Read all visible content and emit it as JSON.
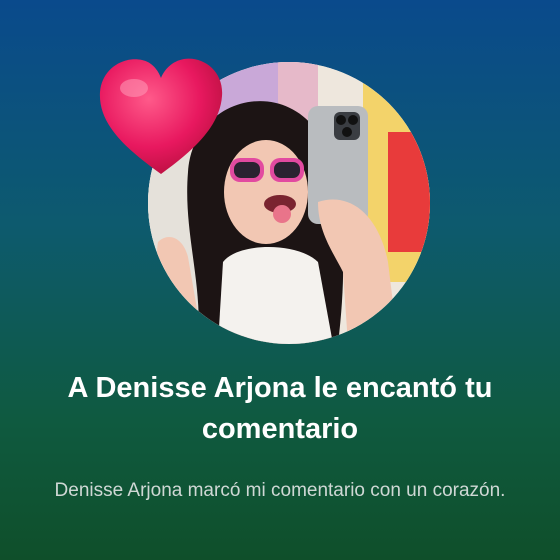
{
  "notification": {
    "title": "A Denisse Arjona le encantó tu comentario",
    "body": "Denisse Arjona marcó mi comentario con un corazón."
  },
  "avatar": {
    "icon": "profile-photo"
  },
  "reaction": {
    "icon": "heart-icon",
    "color": "#e8185f"
  },
  "colors": {
    "background_top": "#0a4a8c",
    "background_bottom": "#0f4f2a",
    "title": "#ffffff",
    "body": "#cfd8d5"
  }
}
